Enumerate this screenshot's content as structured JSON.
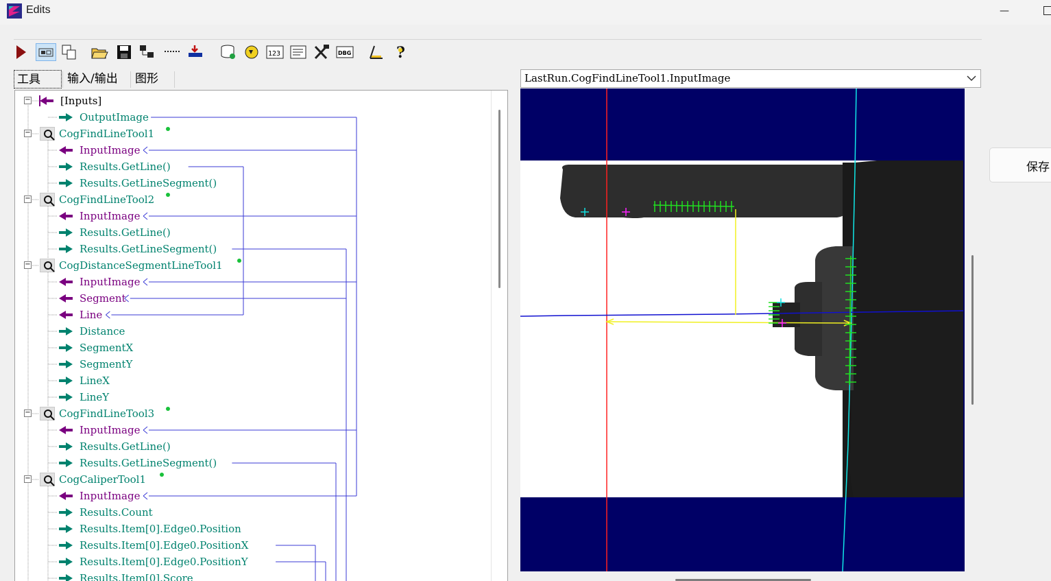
{
  "window": {
    "title": "Edits",
    "minimize_glyph": "—"
  },
  "toolbar": {
    "buttons": [
      "run-icon",
      "toggle-view-icon",
      "copy-icon",
      "open-folder-icon",
      "save-icon",
      "network-icon",
      "dotted-icon",
      "import-icon",
      "database-icon",
      "refresh-icon",
      "counter-icon",
      "list-icon",
      "tools-icon",
      "debug-icon",
      "measure-icon",
      "help-icon"
    ],
    "counter_label": "123",
    "debug_label": "DBG"
  },
  "tabs": [
    {
      "label": "工具",
      "active": true
    },
    {
      "label": "输入/输出",
      "active": false
    },
    {
      "label": "图形",
      "active": false
    }
  ],
  "tree": {
    "rows": [
      {
        "text": "[Inputs]",
        "kind": "node"
      },
      {
        "text": "OutputImage",
        "kind": "out"
      },
      {
        "text": "CogFindLineTool1",
        "kind": "tool"
      },
      {
        "text": "InputImage",
        "kind": "in"
      },
      {
        "text": "Results.GetLine()",
        "kind": "out"
      },
      {
        "text": "Results.GetLineSegment()",
        "kind": "out"
      },
      {
        "text": "CogFindLineTool2",
        "kind": "tool"
      },
      {
        "text": "InputImage",
        "kind": "in"
      },
      {
        "text": "Results.GetLine()",
        "kind": "out"
      },
      {
        "text": "Results.GetLineSegment()",
        "kind": "out"
      },
      {
        "text": "CogDistanceSegmentLineTool1",
        "kind": "tool"
      },
      {
        "text": "InputImage",
        "kind": "in"
      },
      {
        "text": "Segment",
        "kind": "in"
      },
      {
        "text": "Line",
        "kind": "in"
      },
      {
        "text": "Distance",
        "kind": "out"
      },
      {
        "text": "SegmentX",
        "kind": "out"
      },
      {
        "text": "SegmentY",
        "kind": "out"
      },
      {
        "text": "LineX",
        "kind": "out"
      },
      {
        "text": "LineY",
        "kind": "out"
      },
      {
        "text": "CogFindLineTool3",
        "kind": "tool"
      },
      {
        "text": "InputImage",
        "kind": "in"
      },
      {
        "text": "Results.GetLine()",
        "kind": "out"
      },
      {
        "text": "Results.GetLineSegment()",
        "kind": "out"
      },
      {
        "text": "CogCaliperTool1",
        "kind": "tool"
      },
      {
        "text": "InputImage",
        "kind": "in"
      },
      {
        "text": "Results.Count",
        "kind": "out"
      },
      {
        "text": "Results.Item[0].Edge0.Position",
        "kind": "out"
      },
      {
        "text": "Results.Item[0].Edge0.PositionX",
        "kind": "out"
      },
      {
        "text": "Results.Item[0].Edge0.PositionY",
        "kind": "out"
      },
      {
        "text": "Results.Item[0].Score",
        "kind": "out"
      }
    ]
  },
  "viewer": {
    "selected_image": "LastRun.CogFindLineTool1.InputImage"
  },
  "side": {
    "save_label": "保存"
  },
  "colors": {
    "tool_text": "#00826e",
    "input_text": "#7a0080",
    "link_line": "#3a3ad6",
    "image_background": "#000066"
  }
}
